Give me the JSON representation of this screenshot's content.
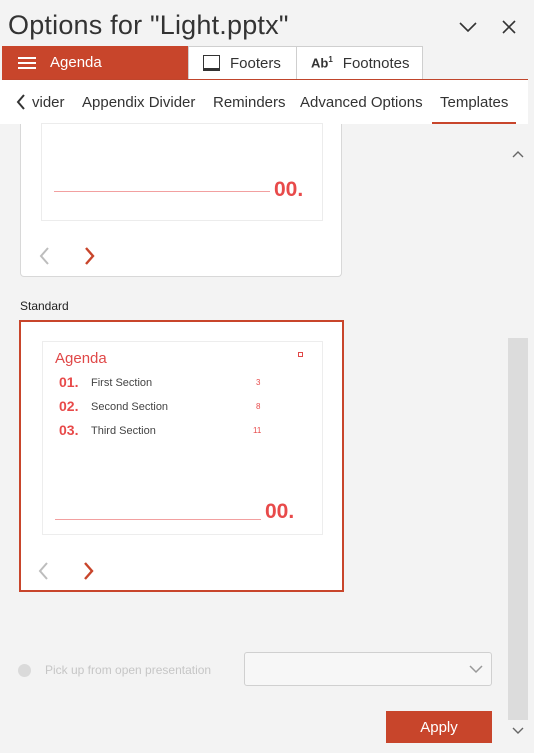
{
  "window": {
    "title": "Options for \"Light.pptx\"",
    "minimize_icon": "chevron-down-icon",
    "close_icon": "close-icon"
  },
  "primary_tabs": [
    {
      "label": "Agenda",
      "icon": "hamburger-icon",
      "active": true
    },
    {
      "label": "Footers",
      "icon": "footer-icon",
      "active": false
    },
    {
      "label": "Footnotes",
      "icon": "Ab1",
      "active": false
    }
  ],
  "secondary_tabs": [
    {
      "label": "vider",
      "truncated": true
    },
    {
      "label": "Appendix Divider"
    },
    {
      "label": "Reminders"
    },
    {
      "label": "Advanced Options"
    },
    {
      "label": "Templates",
      "active": true
    }
  ],
  "template_cards": [
    {
      "name": "",
      "preview": {
        "big_number": "00."
      }
    },
    {
      "name": "Standard",
      "selected": true,
      "preview": {
        "title": "Agenda",
        "items": [
          {
            "num": "01.",
            "label": "First Section",
            "page": "3"
          },
          {
            "num": "02.",
            "label": "Second Section",
            "page": "8"
          },
          {
            "num": "03.",
            "label": "Third Section",
            "page": "11"
          }
        ],
        "big_number": "00."
      }
    }
  ],
  "footer": {
    "radio_label": "Pick up from open presentation",
    "select_value": "",
    "apply_label": "Apply"
  },
  "colors": {
    "accent": "#c8452b",
    "slide_accent": "#e84a4a"
  }
}
